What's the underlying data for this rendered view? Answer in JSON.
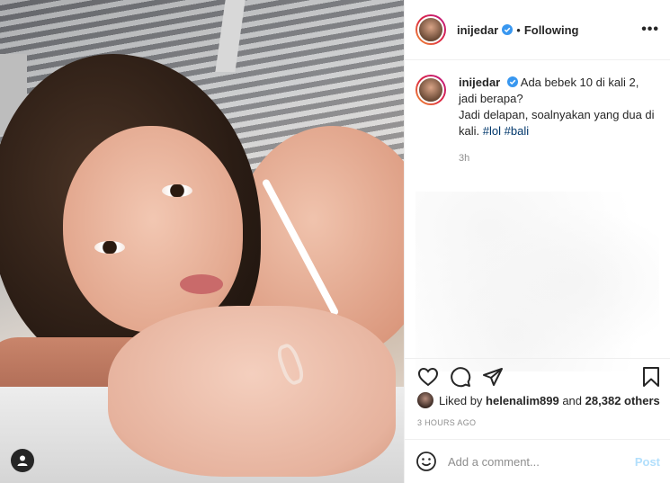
{
  "post": {
    "username": "inijedar",
    "follow_status": "Following",
    "more_label": "•••",
    "caption_line1": "Ada bebek 10 di kali 2, jadi berapa?",
    "caption_line2": "Jadi delapan, soalnyakan yang dua di kali.",
    "hashtags": [
      "#lol",
      "#bali"
    ],
    "caption_time": "3h",
    "liked_by_prefix": "Liked by",
    "liked_by_user": "helenalim899",
    "liked_by_and": "and",
    "likes_others": "28,382 others",
    "post_time": "3 HOURS AGO",
    "comment_placeholder": "Add a comment...",
    "post_label": "Post"
  },
  "colors": {
    "verified": "#3897f0",
    "hashtag": "#00376b",
    "post_button_disabled": "#b2dffc"
  },
  "icons": [
    "verified-icon",
    "more-icon",
    "heart-icon",
    "comment-icon",
    "share-icon",
    "bookmark-icon",
    "emoji-icon",
    "user-tag-icon"
  ]
}
